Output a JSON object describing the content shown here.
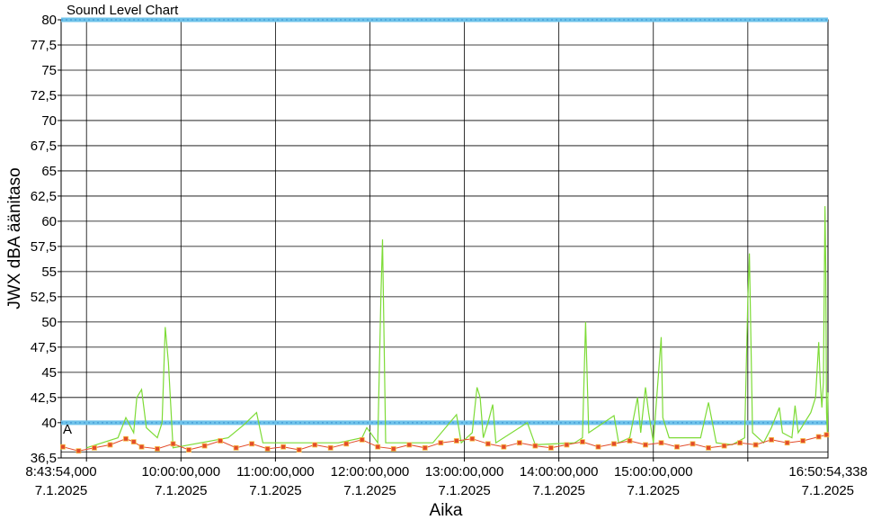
{
  "chart_data": {
    "type": "line",
    "title": "Sound Level Chart",
    "xlabel": "Aika",
    "ylabel": "JWX dBA äänitaso",
    "grid": true,
    "ylim": [
      36.5,
      80
    ],
    "yticks": [
      36.5,
      40,
      42.5,
      45,
      47.5,
      50,
      52.5,
      55,
      57.5,
      60,
      62.5,
      65,
      67.5,
      70,
      72.5,
      75,
      77.5,
      80
    ],
    "xlim": [
      "08:43:54",
      "16:50:54"
    ],
    "xticks": [
      {
        "time": "8:43:54,000",
        "date": "7.1.2025"
      },
      {
        "time": "10:00:00,000",
        "date": "7.1.2025"
      },
      {
        "time": "11:00:00,000",
        "date": "7.1.2025"
      },
      {
        "time": "12:00:00,000",
        "date": "7.1.2025"
      },
      {
        "time": "13:00:00,000",
        "date": "7.1.2025"
      },
      {
        "time": "14:00:00,000",
        "date": "7.1.2025"
      },
      {
        "time": "15:00:00,000",
        "date": "7.1.2025"
      },
      {
        "time": "16:50:54,338",
        "date": "7.1.2025"
      }
    ],
    "threshold_lines": [
      {
        "label": "A",
        "value": 40,
        "color": "#6fc3ea"
      },
      {
        "label": "",
        "value": 80,
        "color": "#6fc3ea"
      }
    ],
    "series": [
      {
        "color": "#7ddb36",
        "points": [
          [
            "09:00:00",
            37.5
          ],
          [
            "09:20:00",
            38.5
          ],
          [
            "09:25:00",
            40.5
          ],
          [
            "09:30:00",
            39.0
          ],
          [
            "09:32:00",
            42.5
          ],
          [
            "09:35:00",
            43.3
          ],
          [
            "09:38:00",
            39.5
          ],
          [
            "09:45:00",
            38.5
          ],
          [
            "09:48:00",
            40.0
          ],
          [
            "09:50:00",
            49.5
          ],
          [
            "09:52:00",
            46.0
          ],
          [
            "09:55:00",
            37.5
          ],
          [
            "10:30:00",
            38.5
          ],
          [
            "10:40:00",
            39.8
          ],
          [
            "10:48:00",
            41.0
          ],
          [
            "10:52:00",
            38.0
          ],
          [
            "11:40:00",
            38.0
          ],
          [
            "11:55:00",
            38.5
          ],
          [
            "11:58:00",
            39.5
          ],
          [
            "12:05:00",
            38.0
          ],
          [
            "12:07:00",
            52.5
          ],
          [
            "12:08:00",
            58.2
          ],
          [
            "12:10:00",
            38.0
          ],
          [
            "12:40:00",
            38.0
          ],
          [
            "12:55:00",
            40.8
          ],
          [
            "12:58:00",
            38.0
          ],
          [
            "13:05:00",
            39.0
          ],
          [
            "13:08:00",
            43.5
          ],
          [
            "13:10:00",
            42.5
          ],
          [
            "13:12:00",
            38.5
          ],
          [
            "13:15:00",
            40.0
          ],
          [
            "13:18:00",
            41.8
          ],
          [
            "13:20:00",
            38.0
          ],
          [
            "13:40:00",
            40.0
          ],
          [
            "13:45:00",
            37.8
          ],
          [
            "14:10:00",
            38.0
          ],
          [
            "14:15:00",
            38.5
          ],
          [
            "14:17:00",
            50.0
          ],
          [
            "14:19:00",
            39.0
          ],
          [
            "14:35:00",
            40.7
          ],
          [
            "14:38:00",
            38.0
          ],
          [
            "14:45:00",
            38.5
          ],
          [
            "14:50:00",
            42.5
          ],
          [
            "14:52:00",
            39.0
          ],
          [
            "14:55:00",
            43.5
          ],
          [
            "14:57:00",
            41.0
          ],
          [
            "15:00:00",
            38.0
          ],
          [
            "15:05:00",
            48.5
          ],
          [
            "15:06:00",
            40.5
          ],
          [
            "15:10:00",
            38.5
          ],
          [
            "15:30:00",
            38.5
          ],
          [
            "15:35:00",
            42.0
          ],
          [
            "15:40:00",
            38.0
          ],
          [
            "15:50:00",
            37.8
          ],
          [
            "15:58:00",
            38.5
          ],
          [
            "16:00:00",
            52.0
          ],
          [
            "16:01:00",
            56.8
          ],
          [
            "16:03:00",
            39.0
          ],
          [
            "16:10:00",
            38.0
          ],
          [
            "16:15:00",
            39.5
          ],
          [
            "16:20:00",
            41.5
          ],
          [
            "16:22:00",
            39.0
          ],
          [
            "16:28:00",
            38.5
          ],
          [
            "16:30:00",
            41.7
          ],
          [
            "16:32:00",
            39.0
          ],
          [
            "16:40:00",
            41.0
          ],
          [
            "16:43:00",
            42.5
          ],
          [
            "16:45:00",
            48.0
          ],
          [
            "16:46:00",
            44.0
          ],
          [
            "16:47:00",
            41.5
          ],
          [
            "16:48:00",
            44.0
          ],
          [
            "16:49:00",
            61.5
          ],
          [
            "16:49:30",
            55.5
          ],
          [
            "16:50:00",
            41.0
          ],
          [
            "16:50:30",
            39.0
          ],
          [
            "16:50:54",
            43.0
          ]
        ]
      },
      {
        "color": "#e24b2a",
        "marker": "square",
        "points": [
          [
            "08:45:00",
            37.6
          ],
          [
            "08:55:00",
            37.2
          ],
          [
            "09:05:00",
            37.5
          ],
          [
            "09:15:00",
            37.8
          ],
          [
            "09:25:00",
            38.4
          ],
          [
            "09:30:00",
            38.1
          ],
          [
            "09:35:00",
            37.6
          ],
          [
            "09:45:00",
            37.4
          ],
          [
            "09:55:00",
            37.9
          ],
          [
            "10:05:00",
            37.3
          ],
          [
            "10:15:00",
            37.7
          ],
          [
            "10:25:00",
            38.2
          ],
          [
            "10:35:00",
            37.5
          ],
          [
            "10:45:00",
            37.9
          ],
          [
            "10:55:00",
            37.4
          ],
          [
            "11:05:00",
            37.6
          ],
          [
            "11:15:00",
            37.3
          ],
          [
            "11:25:00",
            37.8
          ],
          [
            "11:35:00",
            37.5
          ],
          [
            "11:45:00",
            37.9
          ],
          [
            "11:55:00",
            38.3
          ],
          [
            "12:05:00",
            37.6
          ],
          [
            "12:15:00",
            37.4
          ],
          [
            "12:25:00",
            37.8
          ],
          [
            "12:35:00",
            37.5
          ],
          [
            "12:45:00",
            38.0
          ],
          [
            "12:55:00",
            38.2
          ],
          [
            "13:05:00",
            38.4
          ],
          [
            "13:15:00",
            37.9
          ],
          [
            "13:25:00",
            37.6
          ],
          [
            "13:35:00",
            38.0
          ],
          [
            "13:45:00",
            37.7
          ],
          [
            "13:55:00",
            37.5
          ],
          [
            "14:05:00",
            37.8
          ],
          [
            "14:15:00",
            38.1
          ],
          [
            "14:25:00",
            37.6
          ],
          [
            "14:35:00",
            37.9
          ],
          [
            "14:45:00",
            38.2
          ],
          [
            "14:55:00",
            37.8
          ],
          [
            "15:05:00",
            38.0
          ],
          [
            "15:15:00",
            37.6
          ],
          [
            "15:25:00",
            37.9
          ],
          [
            "15:35:00",
            37.5
          ],
          [
            "15:45:00",
            37.7
          ],
          [
            "15:55:00",
            38.0
          ],
          [
            "16:05:00",
            37.8
          ],
          [
            "16:15:00",
            38.3
          ],
          [
            "16:25:00",
            38.0
          ],
          [
            "16:35:00",
            38.2
          ],
          [
            "16:45:00",
            38.6
          ],
          [
            "16:50:00",
            38.8
          ]
        ]
      }
    ]
  }
}
